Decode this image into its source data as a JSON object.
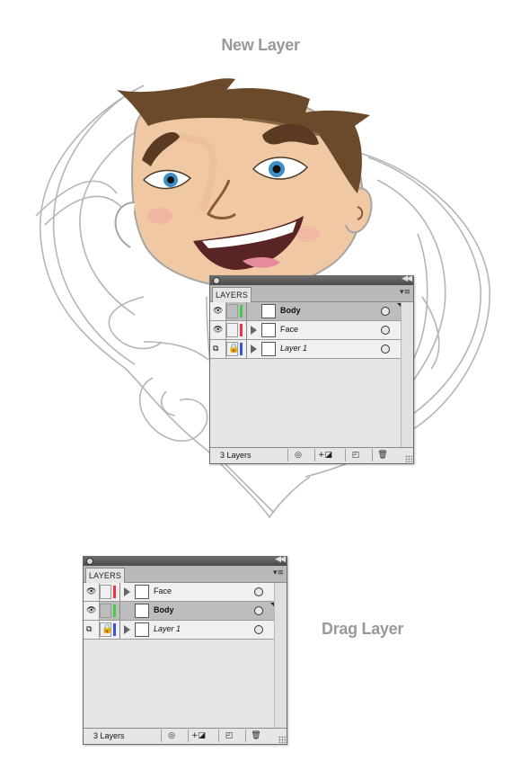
{
  "titles": {
    "new_layer": "New Layer",
    "drag_layer": "Drag Layer"
  },
  "panel_1": {
    "tab_label": "LAYERS",
    "footer_count": "3 Layers",
    "rows": [
      {
        "label": "Body",
        "color": "#44cc44",
        "selected": true,
        "visible_icon": "eye-icon",
        "lock_icon": ""
      },
      {
        "label": "Face",
        "color": "#ee3344",
        "selected": false,
        "visible_icon": "eye-icon",
        "lock_icon": ""
      },
      {
        "label": "Layer 1",
        "color": "#3355dd",
        "selected": false,
        "visible_icon": "template-icon",
        "lock_icon": "lock-icon"
      }
    ]
  },
  "panel_2": {
    "tab_label": "LAYERS",
    "footer_count": "3 Layers",
    "rows": [
      {
        "label": "Face",
        "color": "#ee3344",
        "selected": false,
        "visible_icon": "eye-icon",
        "lock_icon": ""
      },
      {
        "label": "Body",
        "color": "#44cc44",
        "selected": true,
        "visible_icon": "eye-icon",
        "lock_icon": ""
      },
      {
        "label": "Layer 1",
        "color": "#3355dd",
        "selected": false,
        "visible_icon": "template-icon",
        "lock_icon": "lock-icon"
      }
    ]
  },
  "colors": {
    "highlight_ring": "#1aa3dd",
    "hair": "#6b4a2b",
    "skin": "#f0c9a4"
  }
}
